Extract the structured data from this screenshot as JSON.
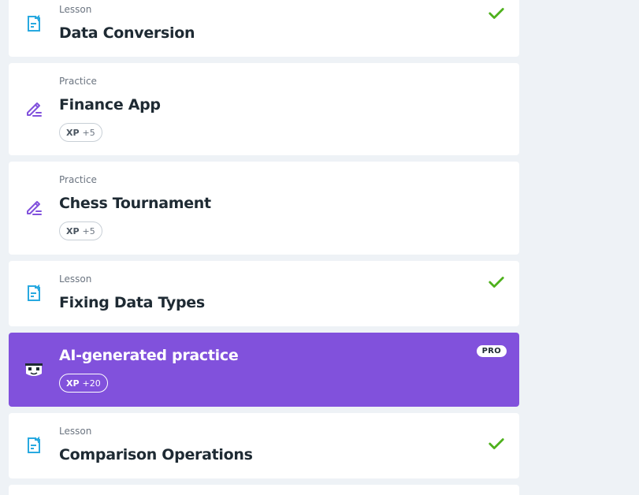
{
  "items": [
    {
      "type": "Lesson",
      "title": "Data Conversion",
      "completed": true
    },
    {
      "type": "Practice",
      "title": "Finance App",
      "xp_label": "XP",
      "xp_value": "+5"
    },
    {
      "type": "Practice",
      "title": "Chess Tournament",
      "xp_label": "XP",
      "xp_value": "+5"
    },
    {
      "type": "Lesson",
      "title": "Fixing Data Types",
      "completed": true
    },
    {
      "type": "",
      "title": "AI-generated practice",
      "xp_label": "XP",
      "xp_value": "+20",
      "badge": "PRO"
    },
    {
      "type": "Lesson",
      "title": "Comparison Operations",
      "completed": true
    }
  ],
  "colors": {
    "lesson_icon": "#28a9e0",
    "practice_icon": "#8151dc",
    "check": "#4eb11c",
    "pro_card": "#8151dc",
    "background": "#eef2f6"
  },
  "icons": {
    "lesson": "lesson-note-icon",
    "practice": "pencil-edit-icon",
    "ai": "ai-bot-face-icon",
    "completed": "checkmark-icon"
  }
}
